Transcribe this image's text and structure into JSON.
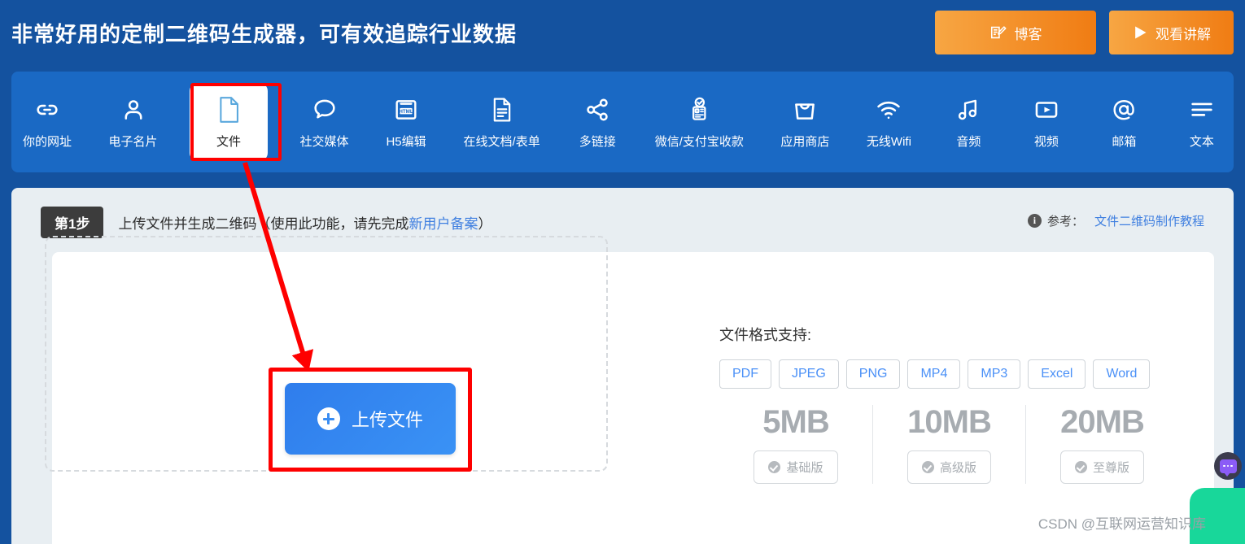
{
  "header": {
    "title": "非常好用的定制二维码生成器，可有效追踪行业数据",
    "blog_button": "博客",
    "watch_button": "观看讲解"
  },
  "nav": {
    "items": [
      {
        "label": "你的网址",
        "icon": "link-icon"
      },
      {
        "label": "电子名片",
        "icon": "person-icon"
      },
      {
        "label": "文件",
        "icon": "document-icon",
        "active": true
      },
      {
        "label": "社交媒体",
        "icon": "chat-icon"
      },
      {
        "label": "H5编辑",
        "icon": "html-icon"
      },
      {
        "label": "在线文档/表单",
        "icon": "form-icon"
      },
      {
        "label": "多链接",
        "icon": "share-icon"
      },
      {
        "label": "微信/支付宝收款",
        "icon": "payment-icon"
      },
      {
        "label": "应用商店",
        "icon": "shop-bag-icon"
      },
      {
        "label": "无线Wifi",
        "icon": "wifi-icon"
      },
      {
        "label": "音频",
        "icon": "music-note-icon"
      },
      {
        "label": "视频",
        "icon": "video-play-icon"
      },
      {
        "label": "邮箱",
        "icon": "at-sign-icon"
      },
      {
        "label": "文本",
        "icon": "text-lines-icon"
      }
    ]
  },
  "step": {
    "badge": "第1步",
    "text_before": "上传文件并生成二维码（使用此功能，请先完成",
    "link": "新用户备案",
    "text_after": "）",
    "reference_label": "参考：",
    "reference_link": "文件二维码制作教程"
  },
  "upload": {
    "button_label": "上传文件"
  },
  "formats": {
    "title": "文件格式支持:",
    "items": [
      "PDF",
      "JPEG",
      "PNG",
      "MP4",
      "MP3",
      "Excel",
      "Word"
    ]
  },
  "tiers": [
    {
      "size": "5MB",
      "plan": "基础版"
    },
    {
      "size": "10MB",
      "plan": "高级版"
    },
    {
      "size": "20MB",
      "plan": "至尊版"
    }
  ],
  "watermark": "CSDN @互联网运营知识库",
  "colors": {
    "header_blue": "#14529f",
    "nav_blue": "#1a69c4",
    "orange_button": "#f07c13",
    "upload_blue": "#3a8df2",
    "link_blue": "#3f7fe0",
    "annotation_red": "#fe0000",
    "card_gray": "#e8eef2",
    "tier_gray": "#a7acb1",
    "widget_green": "#18d79a"
  }
}
